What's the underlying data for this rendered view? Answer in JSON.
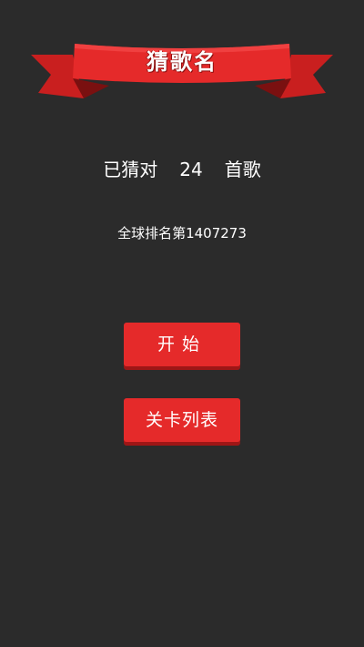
{
  "header": {
    "title": "猜歌名"
  },
  "score": {
    "prefix": "已猜对",
    "count": "24",
    "suffix": "首歌"
  },
  "rank": {
    "text": "全球排名第1407273"
  },
  "buttons": {
    "start_label": "开始",
    "levels_label": "关卡列表"
  },
  "colors": {
    "background": "#2b2b2b",
    "accent": "#e52a2a",
    "accent_dark": "#9e1616"
  }
}
